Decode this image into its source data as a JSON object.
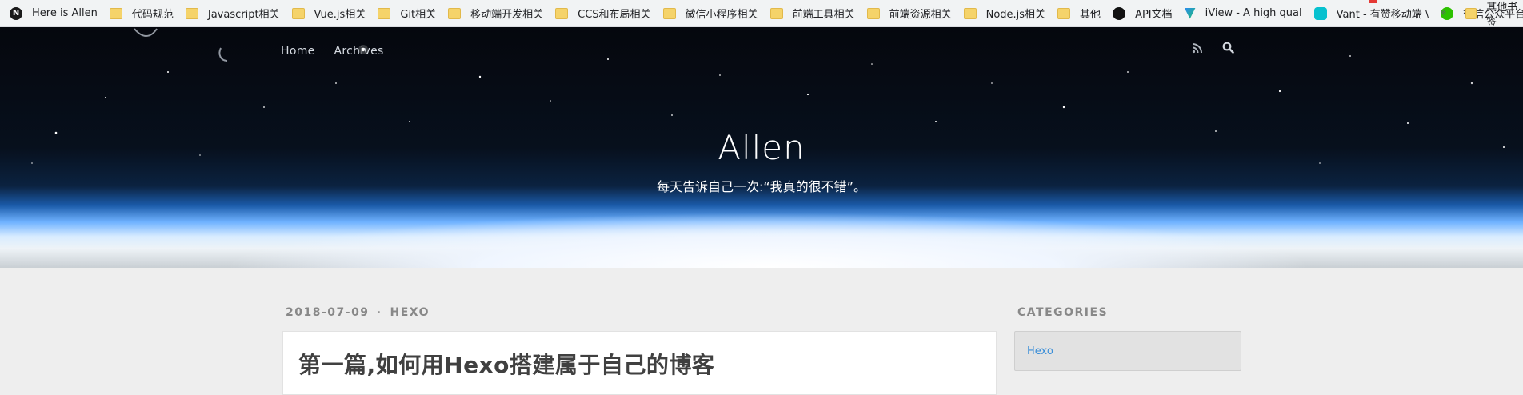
{
  "bookmarks": [
    {
      "label": "Here is Allen",
      "icon": "notion-n-icon"
    },
    {
      "label": "代码规范",
      "icon": "folder-icon"
    },
    {
      "label": "Javascript相关",
      "icon": "folder-icon"
    },
    {
      "label": "Vue.js相关",
      "icon": "folder-icon"
    },
    {
      "label": "Git相关",
      "icon": "folder-icon"
    },
    {
      "label": "移动端开发相关",
      "icon": "folder-icon"
    },
    {
      "label": "CCS和布局相关",
      "icon": "folder-icon"
    },
    {
      "label": "微信小程序相关",
      "icon": "folder-icon"
    },
    {
      "label": "前端工具相关",
      "icon": "folder-icon"
    },
    {
      "label": "前端资源相关",
      "icon": "folder-icon"
    },
    {
      "label": "Node.js相关",
      "icon": "folder-icon"
    },
    {
      "label": "其他",
      "icon": "folder-icon"
    },
    {
      "label": "API文档",
      "icon": "api-doc-icon"
    },
    {
      "label": "iView - A high qual",
      "icon": "iview-logo-icon"
    },
    {
      "label": "Vant - 有赞移动端 \\",
      "icon": "vant-logo-icon"
    },
    {
      "label": "微信公众平台",
      "icon": "wechat-icon"
    }
  ],
  "bookmarks_more": "»",
  "other_bookmarks": "其他书签",
  "nav": {
    "home": "Home",
    "archives": "Archives"
  },
  "site": {
    "title": "Allen",
    "subtitle": "每天告诉自己一次:“我真的很不错”。"
  },
  "post": {
    "date": "2018-07-09",
    "separator": "·",
    "category": "HEXO",
    "title": "第一篇,如何用Hexo搭建属于自己的博客"
  },
  "sidebar": {
    "heading": "CATEGORIES",
    "categories": [
      "Hexo"
    ]
  }
}
